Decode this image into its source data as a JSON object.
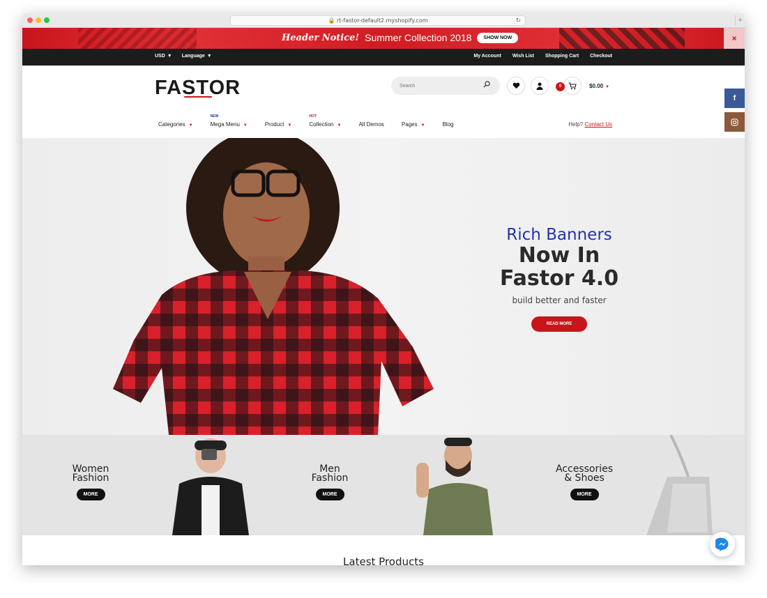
{
  "browser": {
    "url": "rt-fastor-default2.myshopify.com"
  },
  "notice": {
    "emphasis": "Header Notice!",
    "text": "Summer Collection 2018",
    "button": "SHOW NOW",
    "close": "×"
  },
  "topbar": {
    "currency": "USD",
    "language": "Language",
    "links": [
      "My Account",
      "Wish List",
      "Shopping Cart",
      "Checkout"
    ]
  },
  "header": {
    "logo": "FASTOR",
    "search_placeholder": "Search",
    "cart_count": "0",
    "cart_total": "$0.00"
  },
  "nav": {
    "items": [
      {
        "label": "Categories",
        "tag": ""
      },
      {
        "label": "Mega Menu",
        "tag": "NEW"
      },
      {
        "label": "Product",
        "tag": ""
      },
      {
        "label": "Collection",
        "tag": "HOT"
      },
      {
        "label": "All Demos",
        "tag": ""
      },
      {
        "label": "Pages",
        "tag": ""
      },
      {
        "label": "Blog",
        "tag": ""
      }
    ],
    "help_label": "Help?",
    "help_link": "Contact Us"
  },
  "hero": {
    "subtitle": "Rich Banners",
    "title_line1": "Now In",
    "title_line2": "Fastor 4.0",
    "description": "build better and faster",
    "button": "READ MORE"
  },
  "categories": [
    {
      "line1": "Women",
      "line2": "Fashion",
      "button": "MORE"
    },
    {
      "line1": "Men",
      "line2": "Fashion",
      "button": "MORE"
    },
    {
      "line1": "Accessories",
      "line2": "& Shoes",
      "button": "MORE"
    }
  ],
  "latest_title": "Latest Products",
  "social": {
    "facebook": "f"
  },
  "colors": {
    "accent": "#c7151b",
    "topbar": "#1c1c1c",
    "banner_sub": "#2233aa",
    "facebook": "#3b5998",
    "instagram": "#8a5a3b"
  }
}
